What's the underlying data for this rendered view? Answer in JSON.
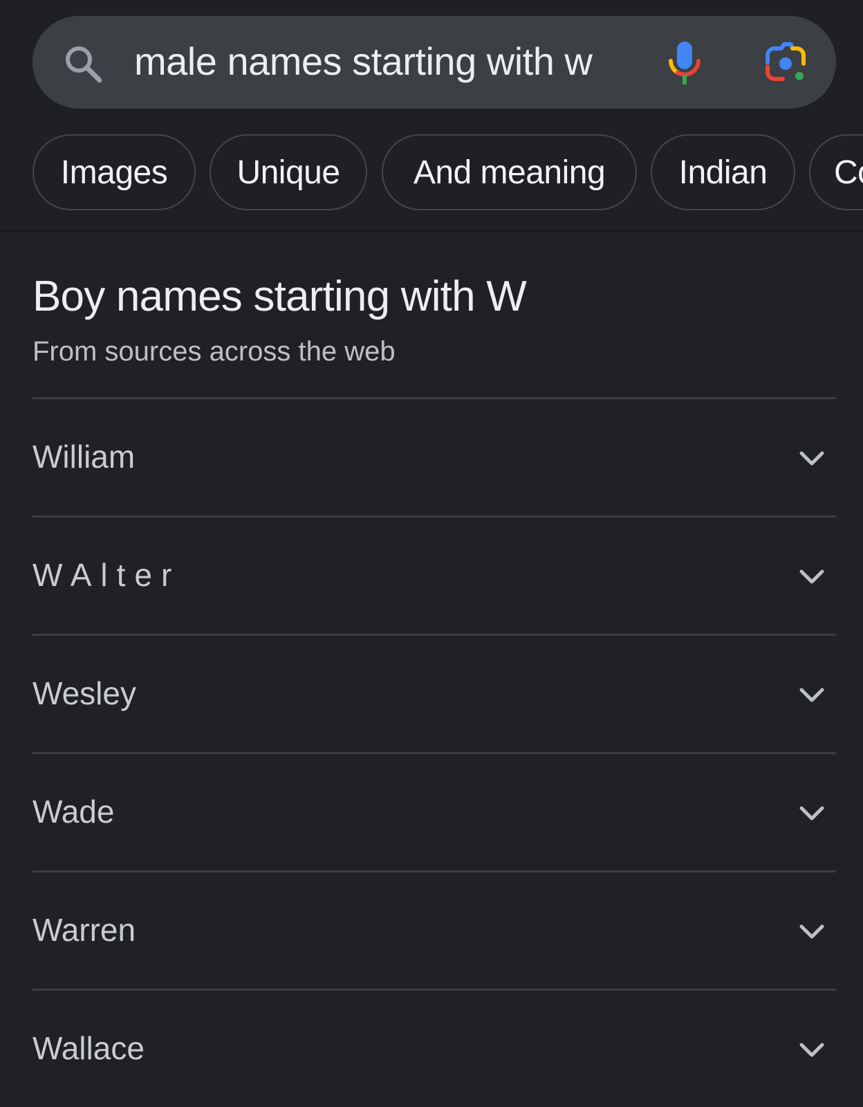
{
  "search": {
    "query": "male names starting with w",
    "icons": {
      "search": "search-icon",
      "voice": "microphone-icon",
      "lens": "google-lens-camera-icon"
    }
  },
  "chips": [
    {
      "label": "Images"
    },
    {
      "label": "Unique"
    },
    {
      "label": "And meaning"
    },
    {
      "label": "Indian"
    },
    {
      "label": "Co"
    }
  ],
  "section": {
    "title": "Boy names starting with W",
    "subtitle": "From sources across the web"
  },
  "names": [
    {
      "label": "William",
      "icon": "chevron-down-icon"
    },
    {
      "label": "WAlter",
      "icon": "chevron-down-icon"
    },
    {
      "label": "Wesley",
      "icon": "chevron-down-icon"
    },
    {
      "label": "Wade",
      "icon": "chevron-down-icon"
    },
    {
      "label": "Warren",
      "icon": "chevron-down-icon"
    },
    {
      "label": "Wallace",
      "icon": "chevron-down-icon"
    }
  ],
  "colors": {
    "background": "#202124",
    "searchbar": "#3c3f43",
    "google_blue": "#4285f4",
    "google_red": "#ea4335",
    "google_yellow": "#fbbc04",
    "google_green": "#34a853"
  }
}
